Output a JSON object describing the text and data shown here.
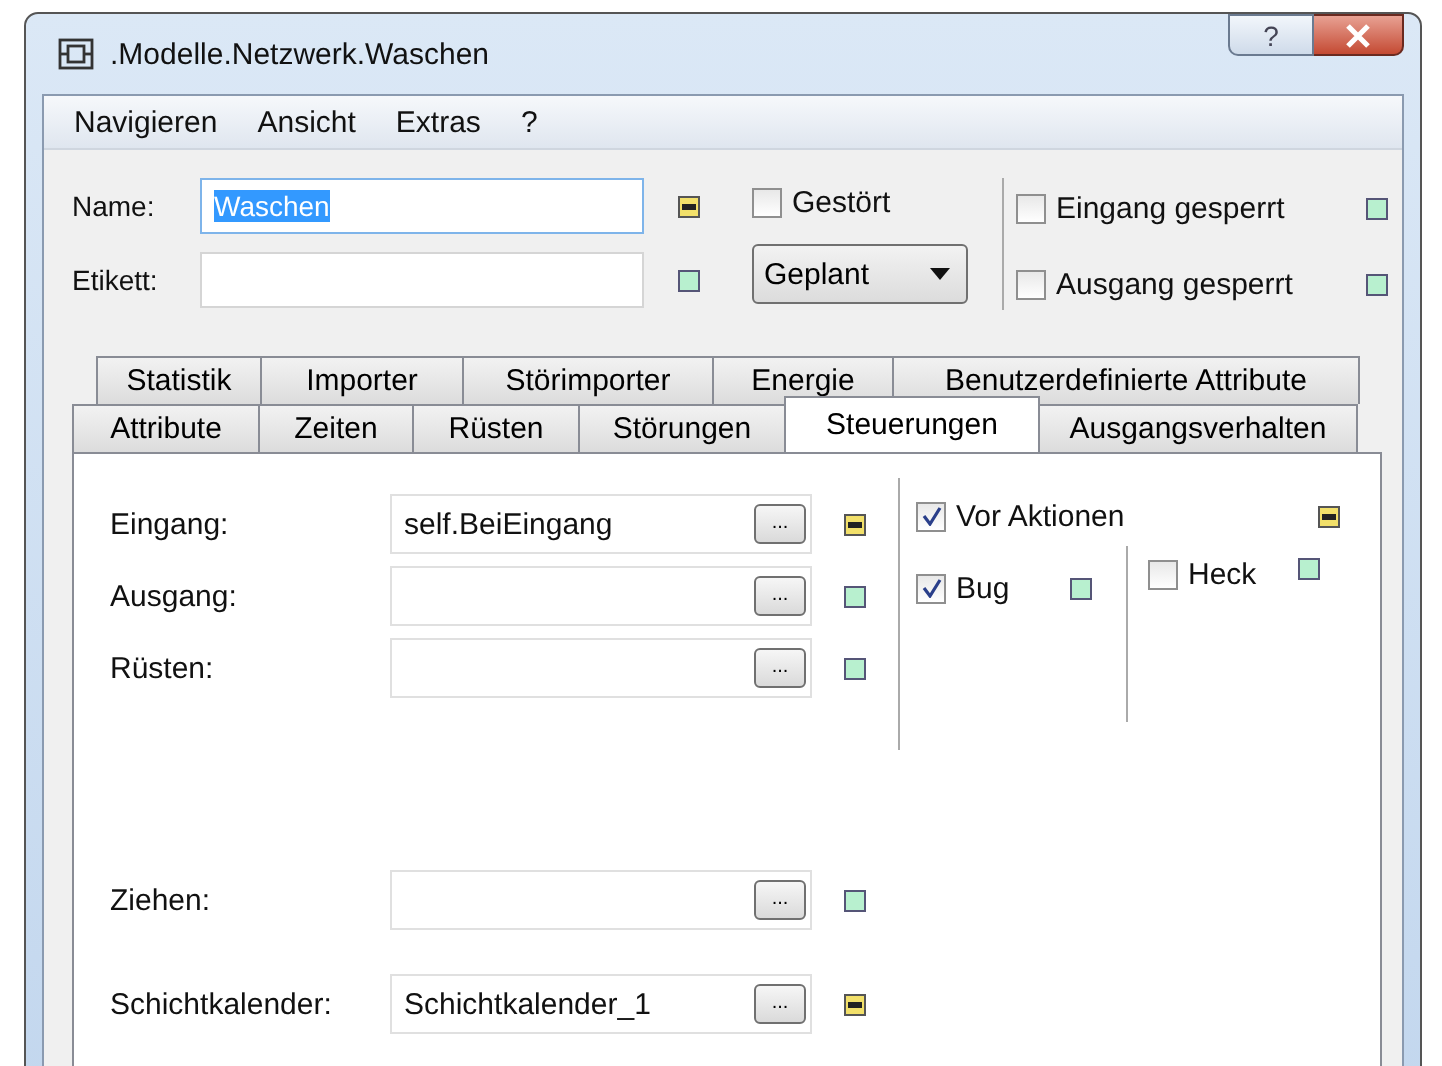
{
  "window": {
    "title": ".Modelle.Netzwerk.Waschen",
    "help": "?"
  },
  "menu": [
    "Navigieren",
    "Ansicht",
    "Extras",
    "?"
  ],
  "header": {
    "fields": [
      {
        "label": "Name:",
        "value": "Waschen",
        "selected": true,
        "inherited": false
      },
      {
        "label": "Etikett:",
        "selected": false,
        "inherited": true
      }
    ],
    "failed": {
      "label": "Gestört",
      "checked": false
    },
    "dropdown": {
      "value": "Geplant"
    },
    "locks": [
      {
        "label": "Eingang gesperrt",
        "checked": false,
        "inherited": true
      },
      {
        "label": "Ausgang gesperrt",
        "checked": false,
        "inherited": true
      }
    ]
  },
  "tabs": [
    [
      {
        "label": "Statistik",
        "selected": false
      },
      {
        "label": "Importer",
        "selected": false
      },
      {
        "label": "Störimporter",
        "selected": false
      },
      {
        "label": "Energie",
        "selected": false
      },
      {
        "label": "Benutzerdefinierte Attribute",
        "selected": false
      }
    ],
    [
      {
        "label": "Attribute",
        "selected": false
      },
      {
        "label": "Zeiten",
        "selected": false
      },
      {
        "label": "Rüsten",
        "selected": false
      },
      {
        "label": "Störungen",
        "selected": false
      },
      {
        "label": "Steuerungen",
        "selected": true
      },
      {
        "label": "Ausgangsverhalten",
        "selected": false
      }
    ]
  ],
  "panel": {
    "fields": [
      {
        "label": "Eingang:",
        "value": "self.BeiEingang",
        "button": "...",
        "inherited": false
      },
      {
        "label": "Ausgang:",
        "button": "...",
        "inherited": true
      },
      {
        "label": "Rüsten:",
        "button": "...",
        "inherited": true
      }
    ],
    "lower_fields": [
      {
        "label": "Ziehen:",
        "button": "...",
        "inherited": true
      },
      {
        "label": "Schichtkalender:",
        "value": "Schichtkalender_1",
        "button": "...",
        "inherited": false
      }
    ],
    "before_actions": {
      "label": "Vor Aktionen",
      "checked": true,
      "inherited": false
    },
    "options": [
      {
        "label": "Bug",
        "checked": true,
        "inherited": true
      },
      {
        "label": "Heck",
        "checked": false,
        "inherited": true
      }
    ]
  }
}
